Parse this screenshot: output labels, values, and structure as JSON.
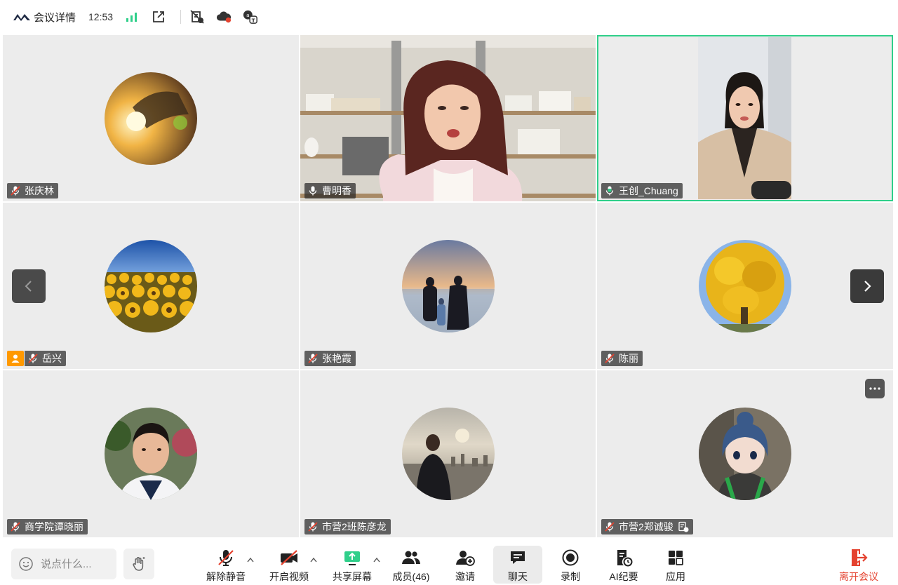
{
  "header": {
    "meeting_title": "会议详情",
    "time": "12:53",
    "icons": [
      "app-logo",
      "signal-strength-icon",
      "open-external-icon",
      "noise-off-icon",
      "cloud-record-icon",
      "translate-icon"
    ]
  },
  "colors": {
    "accent_green": "#2fcf8a",
    "host_orange": "#ff9900",
    "leave_red": "#e4422f",
    "tile_bg": "#ececec"
  },
  "participants": [
    {
      "name": "张庆林",
      "mic": "muted",
      "video": false,
      "avatar": "sunset-hand-avatar"
    },
    {
      "name": "曹明香",
      "mic": "on",
      "video": true,
      "avatar": "video-feed-woman-bookshelf"
    },
    {
      "name": "王创_Chuang",
      "mic": "speaking",
      "video": true,
      "active_speaker": true,
      "avatar": "video-feed-woman-trenchcoat"
    },
    {
      "name": "岳兴",
      "mic": "muted",
      "host": true,
      "video": false,
      "avatar": "sunflowers-avatar"
    },
    {
      "name": "张艳霞",
      "mic": "muted",
      "video": false,
      "avatar": "beach-family-avatar"
    },
    {
      "name": "陈丽",
      "mic": "muted",
      "video": false,
      "avatar": "ginkgo-tree-avatar"
    },
    {
      "name": "商学院谭晓丽",
      "mic": "muted",
      "video": false,
      "avatar": "boy-portrait-avatar"
    },
    {
      "name": "市营2班陈彦龙",
      "mic": "muted",
      "video": false,
      "avatar": "city-skyline-avatar"
    },
    {
      "name": "市营2郑诚骏",
      "mic": "muted",
      "video": false,
      "avatar": "anime-girl-avatar",
      "extra_icon": "notes-badge-icon"
    }
  ],
  "toolbar": {
    "chat_placeholder": "说点什么...",
    "unmute": "解除静音",
    "start_video": "开启视频",
    "share_screen": "共享屏幕",
    "members": "成员(46)",
    "invite": "邀请",
    "chat": "聊天",
    "record": "录制",
    "ai_minutes": "AI纪要",
    "apps": "应用",
    "leave": "离开会议"
  }
}
